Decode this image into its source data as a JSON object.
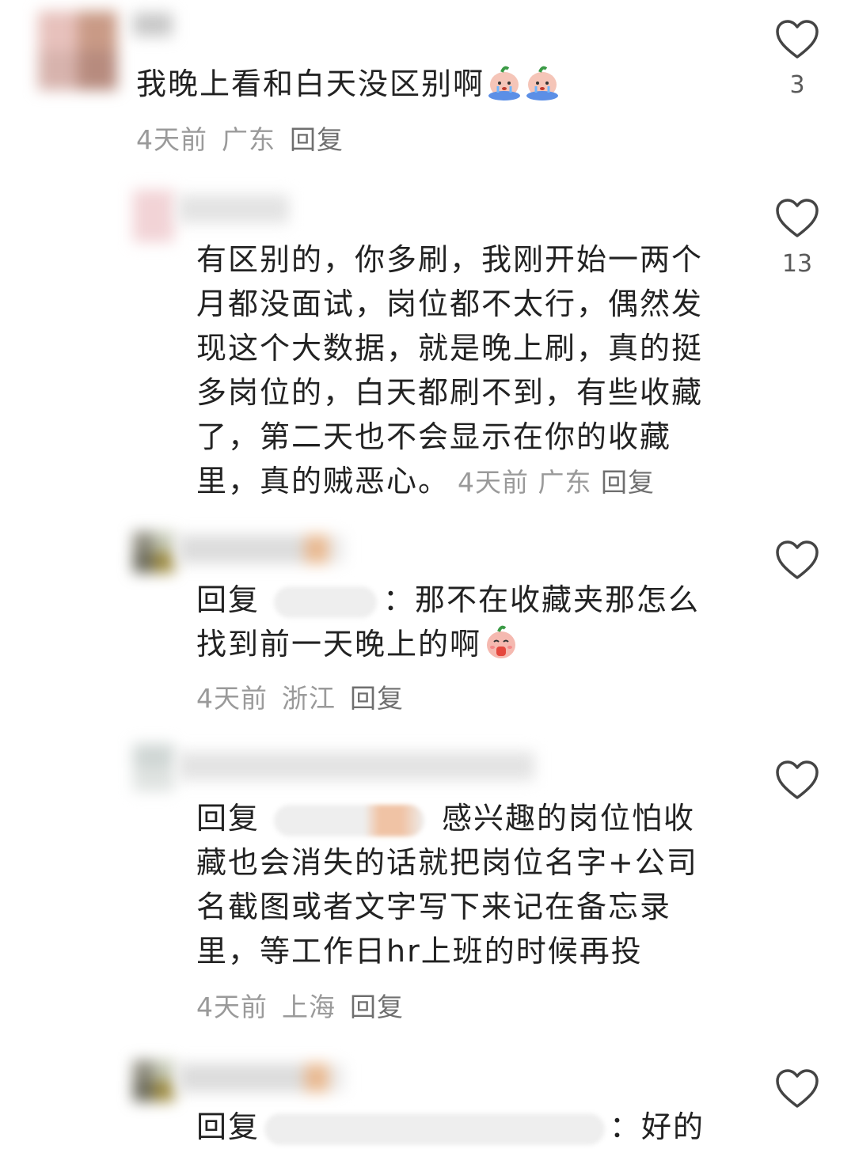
{
  "comments": [
    {
      "text": "我晚上看和白天没区别啊",
      "time": "4天前",
      "location": "广东",
      "reply_label": "回复",
      "likes": "3"
    },
    {
      "text": "有区别的，你多刷，我刚开始一两个月都没面试，岗位都不太行，偶然发现这个大数据，就是晚上刷，真的挺多岗位的，白天都刷不到，有些收藏了，第二天也不会显示在你的收藏里，真的贼恶心。",
      "lines": [
        "有区别的，你多刷，我刚开始一两个",
        "月都没面试，岗位都不太行，偶然发",
        "现这个大数据，就是晚上刷，真的挺",
        "多岗位的，白天都刷不到，有些收藏",
        "了，第二天也不会显示在你的收藏",
        "里，真的贼恶心。"
      ],
      "time": "4天前",
      "location": "广东",
      "reply_label": "回复",
      "likes": "13"
    },
    {
      "prefix": "回复",
      "lines": [
        "：那不在收藏夹那怎么",
        "找到前一天晚上的啊"
      ],
      "time": "4天前",
      "location": "浙江",
      "reply_label": "回复",
      "likes": ""
    },
    {
      "prefix": "回复",
      "lines": [
        "感兴趣的岗位怕收",
        "藏也会消失的话就把岗位名字+公司",
        "名截图或者文字写下来记在备忘录",
        "里，等工作日hr上班的时候再投"
      ],
      "time": "4天前",
      "location": "上海",
      "reply_label": "回复",
      "likes": ""
    },
    {
      "prefix": "回复",
      "lines": [
        "：好的"
      ],
      "likes": ""
    }
  ],
  "icons": {
    "like": "heart-outline-icon",
    "emoji_cry": "crying-peach-emoji",
    "emoji_pray": "praying-peach-emoji"
  },
  "colors": {
    "text": "#222222",
    "meta": "#9a9a9a",
    "reply": "#6f6f6f"
  }
}
